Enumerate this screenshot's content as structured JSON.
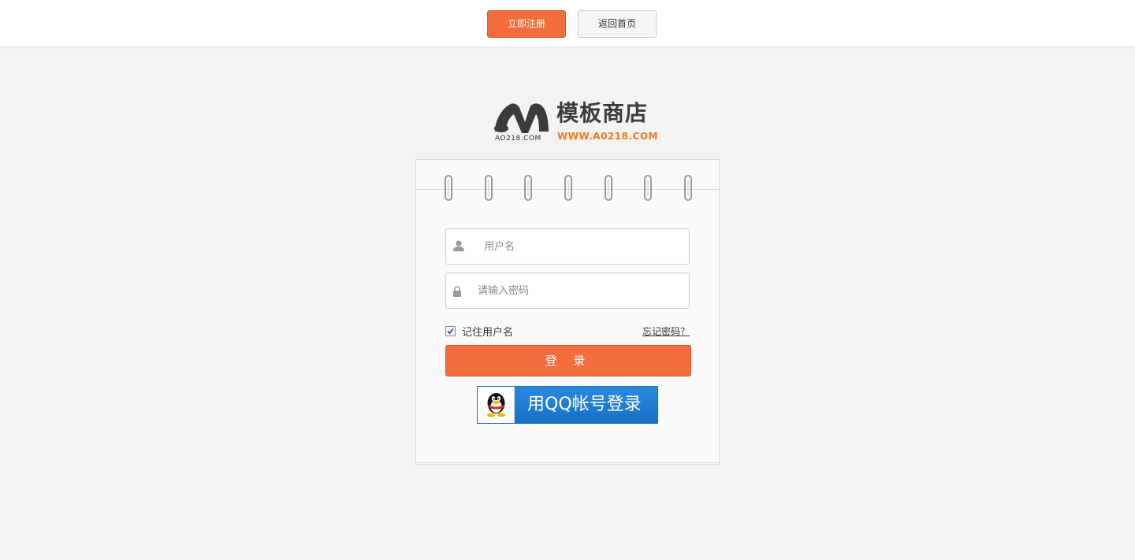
{
  "header": {
    "register_label": "立即注册",
    "home_label": "返回首页"
  },
  "logo": {
    "small_text": "AO218.COM",
    "brand_cn": "模板商店",
    "url_text": "WWW.A0218.COM",
    "accent_color": "#ee7b1f"
  },
  "form": {
    "username_placeholder": "用户名",
    "password_placeholder": "请输入密码",
    "remember_label": "记住用户名",
    "remember_checked": true,
    "forgot_label": "忘记密码？",
    "login_label": "登 录",
    "qq_login_label": "用QQ帐号登录"
  },
  "colors": {
    "primary": "#f26c3c",
    "qq_blue": "#1a7ad4",
    "background": "#f3f3f3"
  }
}
